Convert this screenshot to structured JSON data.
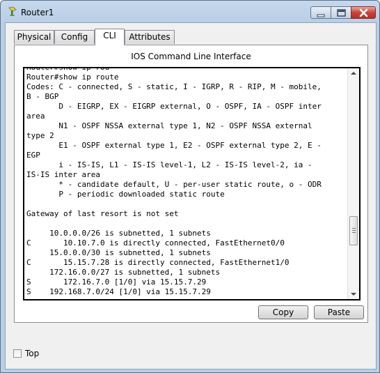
{
  "window": {
    "title": "Router1",
    "app_icon": "router-icon",
    "controls": {
      "minimize": "minimize-icon",
      "maximize": "maximize-icon",
      "close": "close-icon"
    }
  },
  "tabs": [
    {
      "label": "Physical",
      "active": false
    },
    {
      "label": "Config",
      "active": false
    },
    {
      "label": "CLI",
      "active": true
    },
    {
      "label": "Attributes",
      "active": false
    }
  ],
  "panel": {
    "title": "IOS Command Line Interface",
    "cli_output": "Router#show ip rou\nRouter#show ip route\nCodes: C - connected, S - static, I - IGRP, R - RIP, M - mobile,\nB - BGP\n       D - EIGRP, EX - EIGRP external, O - OSPF, IA - OSPF inter\narea\n       N1 - OSPF NSSA external type 1, N2 - OSPF NSSA external\ntype 2\n       E1 - OSPF external type 1, E2 - OSPF external type 2, E -\nEGP\n       i - IS-IS, L1 - IS-IS level-1, L2 - IS-IS level-2, ia -\nIS-IS inter area\n       * - candidate default, U - per-user static route, o - ODR\n       P - periodic downloaded static route\n\nGateway of last resort is not set\n\n     10.0.0.0/26 is subnetted, 1 subnets\nC       10.10.7.0 is directly connected, FastEthernet0/0\n     15.0.0.0/30 is subnetted, 1 subnets\nC       15.15.7.28 is directly connected, FastEthernet1/0\n     172.16.0.0/27 is subnetted, 1 subnets\nS       172.16.7.0 [1/0] via 15.15.7.29\nS    192.168.7.0/24 [1/0] via 15.15.7.29"
  },
  "buttons": {
    "copy": "Copy",
    "paste": "Paste"
  },
  "footer": {
    "top_label": "Top",
    "top_checked": false
  },
  "colors": {
    "title_bar": "#b9cfe6",
    "close_button": "#c8443a"
  }
}
